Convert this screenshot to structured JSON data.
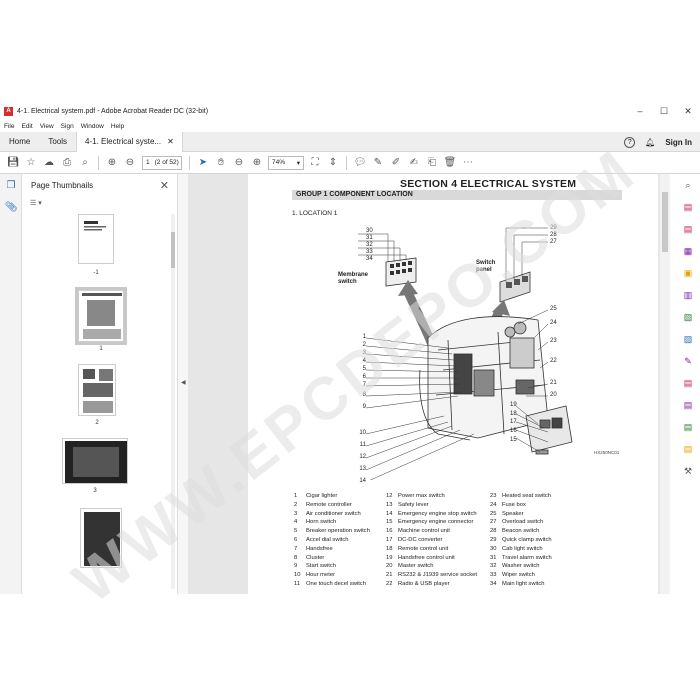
{
  "window": {
    "title": "4-1. Electrical system.pdf - Adobe Acrobat Reader DC (32-bit)"
  },
  "menu": [
    "File",
    "Edit",
    "View",
    "Sign",
    "Window",
    "Help"
  ],
  "tabs": {
    "home": "Home",
    "tools": "Tools",
    "doc": "4-1. Electrical syste..."
  },
  "header_right": {
    "sign_in": "Sign In"
  },
  "toolbar": {
    "page_current": "1",
    "page_total": "(2 of 52)",
    "zoom": "74%"
  },
  "panel": {
    "title": "Page Thumbnails",
    "thumb_labels": [
      "-1",
      "1",
      "2",
      "3"
    ]
  },
  "page": {
    "section": "SECTION  4  ELECTRICAL SYSTEM",
    "group": "GROUP  1  COMPONENT LOCATION",
    "location": "1. LOCATION 1",
    "callout_membrane": "Membrane switch",
    "callout_switch": "Switch panel",
    "figure_id": "HX250NC01",
    "left_numbers": [
      "1",
      "2",
      "3",
      "4",
      "5",
      "6",
      "7",
      "8",
      "9",
      "10",
      "11",
      "12",
      "13",
      "14"
    ],
    "right_numbers": [
      "25",
      "24",
      "23",
      "22",
      "21",
      "20",
      "19",
      "18",
      "17",
      "16",
      "15"
    ],
    "top_left_numbers": [
      "30",
      "31",
      "32",
      "33",
      "34"
    ],
    "top_right_numbers": [
      "29",
      "28",
      "27"
    ],
    "legend": [
      {
        "n": "1",
        "t": "Cigar lighter"
      },
      {
        "n": "2",
        "t": "Remote controller"
      },
      {
        "n": "3",
        "t": "Air conditioner switch"
      },
      {
        "n": "4",
        "t": "Horn switch"
      },
      {
        "n": "5",
        "t": "Breaker operation switch"
      },
      {
        "n": "6",
        "t": "Accel dial switch"
      },
      {
        "n": "7",
        "t": "Handsfree"
      },
      {
        "n": "8",
        "t": "Cluster"
      },
      {
        "n": "9",
        "t": "Start switch"
      },
      {
        "n": "10",
        "t": "Hour meter"
      },
      {
        "n": "11",
        "t": "One touch decel switch"
      },
      {
        "n": "12",
        "t": "Power max switch"
      },
      {
        "n": "13",
        "t": "Safety lever"
      },
      {
        "n": "14",
        "t": "Emergency engine stop switch"
      },
      {
        "n": "15",
        "t": "Emergency engine connector"
      },
      {
        "n": "16",
        "t": "Machine control unit"
      },
      {
        "n": "17",
        "t": "DC-DC converter"
      },
      {
        "n": "18",
        "t": "Remote control unit"
      },
      {
        "n": "19",
        "t": "Handsfree control unit"
      },
      {
        "n": "20",
        "t": "Master switch"
      },
      {
        "n": "21",
        "t": "RS232 & J1939 service socket"
      },
      {
        "n": "22",
        "t": "Radio & USB player"
      },
      {
        "n": "23",
        "t": "Heated seat switch"
      },
      {
        "n": "24",
        "t": "Fuse box"
      },
      {
        "n": "25",
        "t": "Speaker"
      },
      {
        "n": "27",
        "t": "Overload switch"
      },
      {
        "n": "28",
        "t": "Beacon switch"
      },
      {
        "n": "29",
        "t": "Quick clamp switch"
      },
      {
        "n": "30",
        "t": "Cab light switch"
      },
      {
        "n": "31",
        "t": "Travel alarm switch"
      },
      {
        "n": "32",
        "t": "Washer switch"
      },
      {
        "n": "33",
        "t": "Wiper switch"
      },
      {
        "n": "34",
        "t": "Main light switch"
      }
    ]
  },
  "watermark": "WWW.EPCDEPO.COM"
}
